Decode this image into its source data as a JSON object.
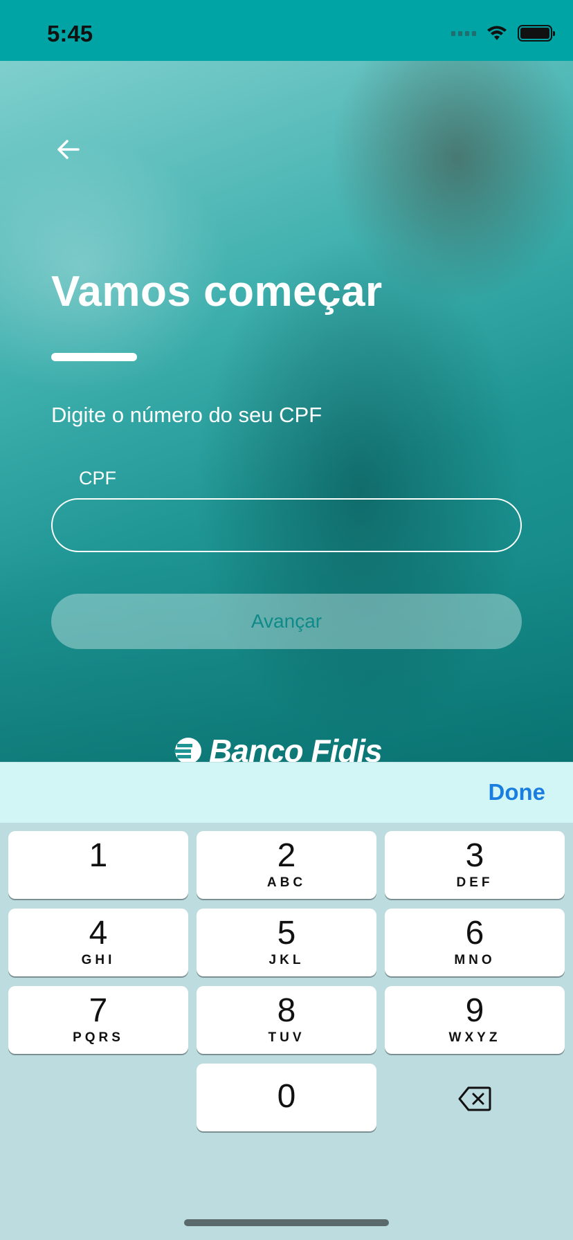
{
  "status_bar": {
    "time": "5:45"
  },
  "screen": {
    "title": "Vamos começar",
    "instruction": "Digite o número do seu CPF",
    "cpf_label": "CPF",
    "cpf_value": "",
    "advance_label": "Avançar",
    "logo_text": "Banco Fidis"
  },
  "accessory": {
    "done_label": "Done"
  },
  "keyboard": {
    "keys": [
      {
        "digit": "1",
        "letters": ""
      },
      {
        "digit": "2",
        "letters": "ABC"
      },
      {
        "digit": "3",
        "letters": "DEF"
      },
      {
        "digit": "4",
        "letters": "GHI"
      },
      {
        "digit": "5",
        "letters": "JKL"
      },
      {
        "digit": "6",
        "letters": "MNO"
      },
      {
        "digit": "7",
        "letters": "PQRS"
      },
      {
        "digit": "8",
        "letters": "TUV"
      },
      {
        "digit": "9",
        "letters": "WXYZ"
      },
      {
        "digit": "0",
        "letters": ""
      }
    ]
  },
  "colors": {
    "status_bar": "#00a4a5",
    "accent_done": "#1a7ee0",
    "button_text": "#0f8a88"
  },
  "icons": [
    "back-arrow-icon",
    "wifi-icon",
    "battery-icon",
    "signal-icon",
    "delete-icon",
    "logo-mark-icon"
  ]
}
